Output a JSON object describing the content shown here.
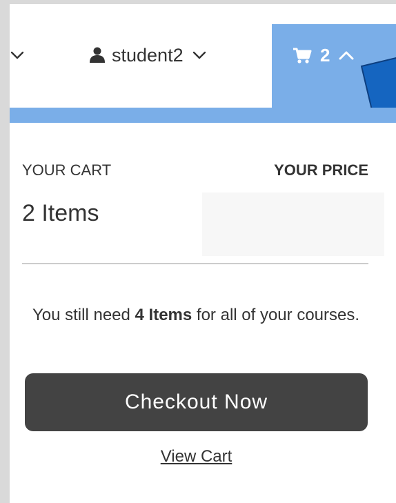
{
  "header": {
    "username": "student2",
    "cart_count": "2",
    "icons": {
      "menu_chevron": "chevron-down-icon",
      "user": "user-icon",
      "user_chevron": "chevron-down-icon",
      "cart": "shopping-cart-icon",
      "cart_chevron": "chevron-up-icon",
      "pointer": "arrow-pointer-icon"
    }
  },
  "cart_dropdown": {
    "your_cart_label": "YOUR CART",
    "your_price_label": "YOUR PRICE",
    "items_count": "2 Items",
    "need_prefix": "You still need ",
    "need_items": "4 Items",
    "need_suffix": " for all of your courses.",
    "checkout_label": "Checkout Now",
    "view_cart_label": "View Cart"
  },
  "colors": {
    "accent_blue": "#7aaee8",
    "button_dark": "#434343",
    "text": "#333333",
    "pointer_blue": "#1565c0"
  }
}
